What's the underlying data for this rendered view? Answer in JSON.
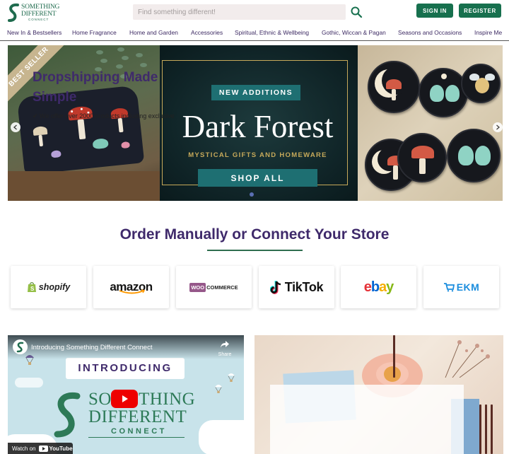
{
  "brand": {
    "line1": "SOMETHING",
    "line2": "DIFFERENT",
    "line3": "CONNECT"
  },
  "header": {
    "search_placeholder": "Find something different!",
    "signin_label": "SIGN IN",
    "register_label": "REGISTER"
  },
  "nav": {
    "items": [
      {
        "label": "New In & Bestsellers"
      },
      {
        "label": "Home Fragrance"
      },
      {
        "label": "Home and Garden"
      },
      {
        "label": "Accessories"
      },
      {
        "label": "Spiritual, Ethnic & Wellbeing"
      },
      {
        "label": "Gothic, Wiccan & Pagan"
      },
      {
        "label": "Seasons and Occasions"
      },
      {
        "label": "Inspire Me"
      }
    ]
  },
  "hero": {
    "ribbon": "BEST SELLER",
    "badge": "NEW ADDITIONS",
    "title": "Dark Forest",
    "subtitle": "MYSTICAL GIFTS AND HOMEWARE",
    "cta": "SHOP ALL"
  },
  "platforms": {
    "heading": "Order Manually or Connect Your Store",
    "items": [
      {
        "name": "shopify"
      },
      {
        "name": "amazon"
      },
      {
        "name_a": "WOO",
        "name_b": "COMMERCE"
      },
      {
        "name": "TikTok"
      },
      {
        "e": "e",
        "b": "b",
        "a": "a",
        "y": "y"
      },
      {
        "name": "EKM"
      }
    ]
  },
  "video": {
    "title": "Introducing Something Different Connect",
    "share_label": "Share",
    "intro": "INTRODUCING",
    "brand_top_a": "SO",
    "brand_top_b": "THING",
    "brand_mid": "DIFFERENT",
    "brand_bottom": "CONNECT",
    "watch_on": "Watch on",
    "youtube": "YouTube"
  },
  "dropship": {
    "title": "Dropshipping Made Simple",
    "text": "✔ We offer over 2000 products including exclusive"
  },
  "colors": {
    "brand_green": "#17704e",
    "brand_purple": "#3f2a6b",
    "teal": "#1e6f72",
    "gold": "#c6a95a"
  }
}
